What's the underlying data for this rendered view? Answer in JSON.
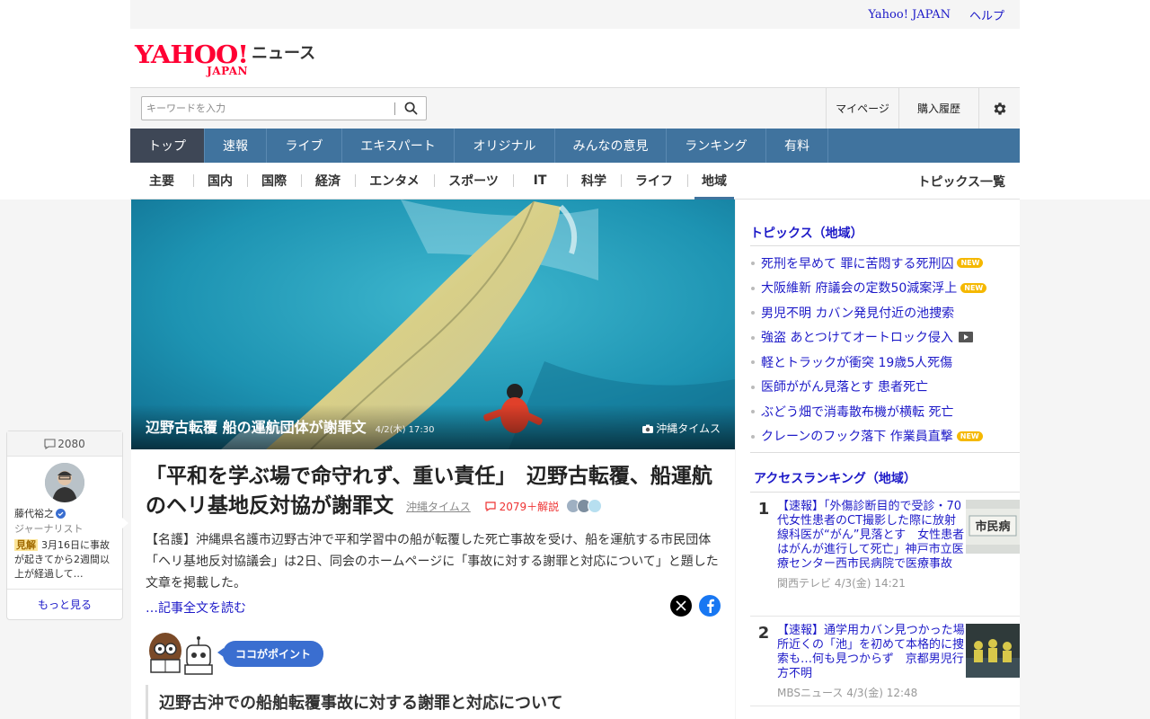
{
  "util": {
    "links": [
      "Yahoo! JAPAN",
      "ヘルプ"
    ]
  },
  "logo": {
    "main": "YAHOO!",
    "sub": "JAPAN",
    "service": "ニュース"
  },
  "search": {
    "placeholder": "キーワードを入力"
  },
  "account": {
    "mypage": "マイページ",
    "history": "購入履歴"
  },
  "mainnav": {
    "items": [
      "トップ",
      "速報",
      "ライブ",
      "エキスパート",
      "オリジナル",
      "みんなの意見",
      "ランキング",
      "有料"
    ],
    "active": "トップ"
  },
  "subnav": {
    "items": [
      "主要",
      "国内",
      "国際",
      "経済",
      "エンタメ",
      "スポーツ",
      "IT",
      "科学",
      "ライフ",
      "地域"
    ],
    "active": "地域",
    "topics_all": "トピックス一覧"
  },
  "hero": {
    "title": "辺野古転覆 船の運航団体が謝罪文",
    "date": "4/2(木) 17:30",
    "credit": "沖縄タイムス"
  },
  "article": {
    "headline": "「平和を学ぶ場で命守れず、重い責任」　辺野古転覆、船運航のヘリ基地反対協が謝罪文",
    "source": "沖縄タイムス",
    "comments": "2079＋解説",
    "summary": "【名護】沖縄県名護市辺野古沖で平和学習中の船が転覆した死亡事故を受け、船を運航する市民団体「ヘリ基地反対協議会」は2日、同会のホームページに「事故に対する謝罪と対応について」と題した文章を掲載した。",
    "read_more": "…記事全文を読む",
    "point_label": "ココがポイント",
    "point_title": "辺野古沖での船舶転覆事故に対する謝罪と対応について"
  },
  "topics": {
    "heading": "トピックス（地域）",
    "items": [
      {
        "text": "死刑を早めて 罪に苦悶する死刑囚",
        "badge": "NEW"
      },
      {
        "text": "大阪維新 府議会の定数50減案浮上",
        "badge": "NEW"
      },
      {
        "text": "男児不明 カバン発見付近の池捜索",
        "badge": ""
      },
      {
        "text": "強盗 あとつけてオートロック侵入",
        "badge": "video"
      },
      {
        "text": "軽とトラックが衝突 19歳5人死傷",
        "badge": ""
      },
      {
        "text": "医師ががん見落とす 患者死亡",
        "badge": ""
      },
      {
        "text": "ぶどう畑で消毒散布機が横転 死亡",
        "badge": ""
      },
      {
        "text": "クレーンのフック落下 作業員直撃",
        "badge": "NEW"
      }
    ]
  },
  "ranking": {
    "heading": "アクセスランキング（地域）",
    "items": [
      {
        "rank": "1",
        "title": "【速報】「外傷診断目的で受診・70代女性患者のCT撮影した際に放射線科医が“がん”見落とす　女性患者はがんが進行して死亡」神戸市立医療センター西市民病院で医療事故",
        "meta": "関西テレビ 4/3(金) 14:21"
      },
      {
        "rank": "2",
        "title": "【速報】通学用カバン見つかった場所近くの「池」を初めて本格的に捜索も…何も見つからず　京都男児行方不明",
        "meta": "MBSニュース 4/3(金) 12:48"
      }
    ]
  },
  "expert": {
    "count": "2080",
    "name": "藤代裕之",
    "role": "ジャーナリスト",
    "label": "見解",
    "text": "3月16日に事故が起きてから2週間以上が経過して…",
    "more": "もっと見る"
  },
  "colors": {
    "nav": "#40739e",
    "nav_active": "#3e4756",
    "link": "#1d1ac8",
    "brand": "#ff0033",
    "new_badge": "#f5b800"
  }
}
